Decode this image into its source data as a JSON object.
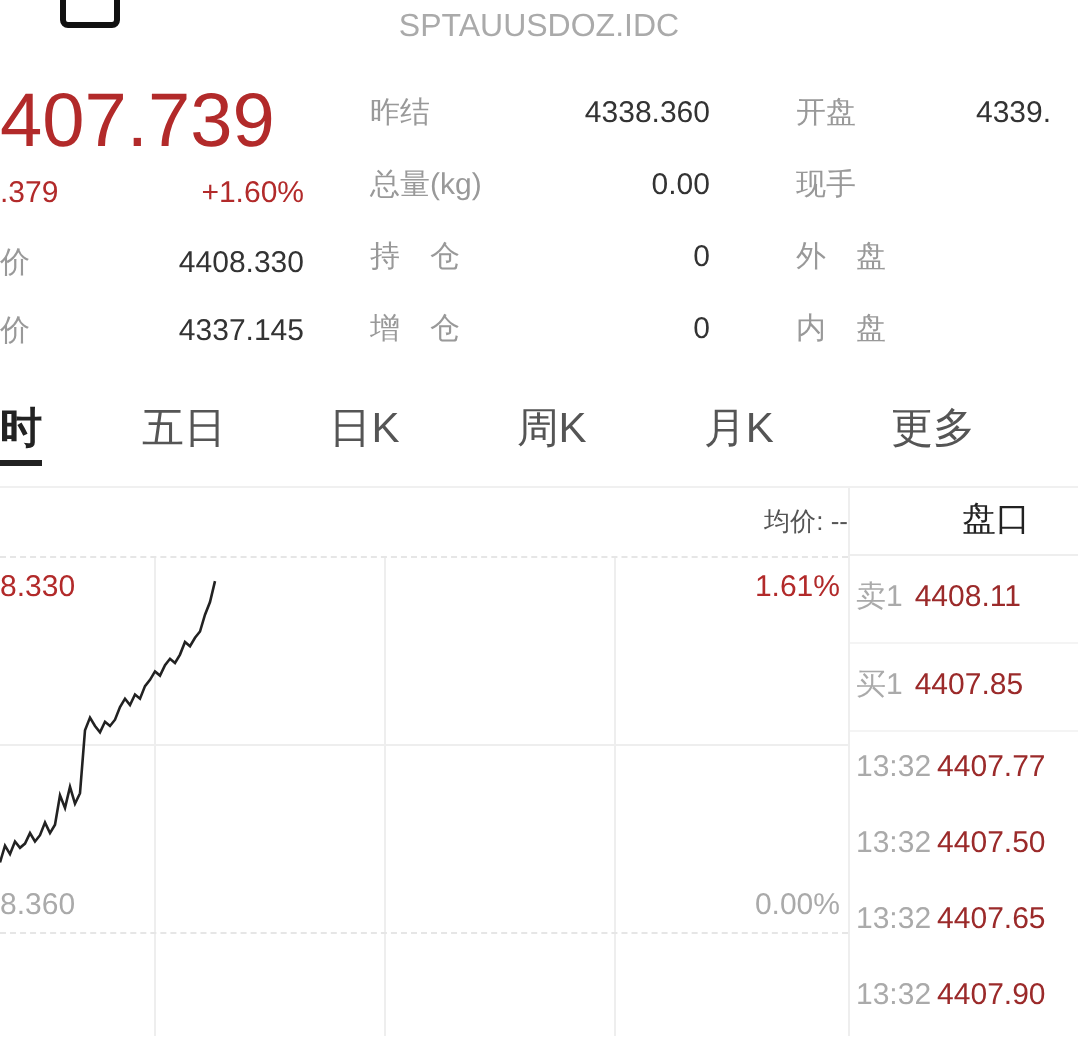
{
  "header": {
    "title": "SPTAUUSDOZ.IDC"
  },
  "quote": {
    "price": "407.739",
    "change": ".379",
    "change_pct": "+1.60%",
    "high_label": "价",
    "high": "4408.330",
    "low_label": "价",
    "low": "4337.145"
  },
  "stats": [
    {
      "label": "昨结",
      "value": "4338.360",
      "label2": "开盘",
      "value2": "4339."
    },
    {
      "label": "总量(kg)",
      "value": "0.00",
      "label2": "现手"
    },
    {
      "label": "持　仓",
      "value": "0",
      "label2": "外　盘"
    },
    {
      "label": "增　仓",
      "value": "0",
      "label2": "内　盘"
    }
  ],
  "tabs": [
    {
      "label": "时",
      "selected": true
    },
    {
      "label": "五日",
      "selected": false
    },
    {
      "label": "日K",
      "selected": false
    },
    {
      "label": "周K",
      "selected": false
    },
    {
      "label": "月K",
      "selected": false
    },
    {
      "label": "更多",
      "selected": false
    }
  ],
  "chart": {
    "avg_label": "均价: --",
    "top_price": "8.330",
    "top_pct": "1.61%",
    "base_price": "8.360",
    "base_pct": "0.00%"
  },
  "panel": {
    "title": "盘口",
    "quotes": [
      {
        "label": "卖1",
        "price": "4408.11"
      },
      {
        "label": "买1",
        "price": "4407.85"
      }
    ],
    "trades": [
      {
        "time": "13:32",
        "price": "4407.77"
      },
      {
        "time": "13:32",
        "price": "4407.50"
      },
      {
        "time": "13:32",
        "price": "4407.65"
      },
      {
        "time": "13:32",
        "price": "4407.90"
      }
    ]
  }
}
